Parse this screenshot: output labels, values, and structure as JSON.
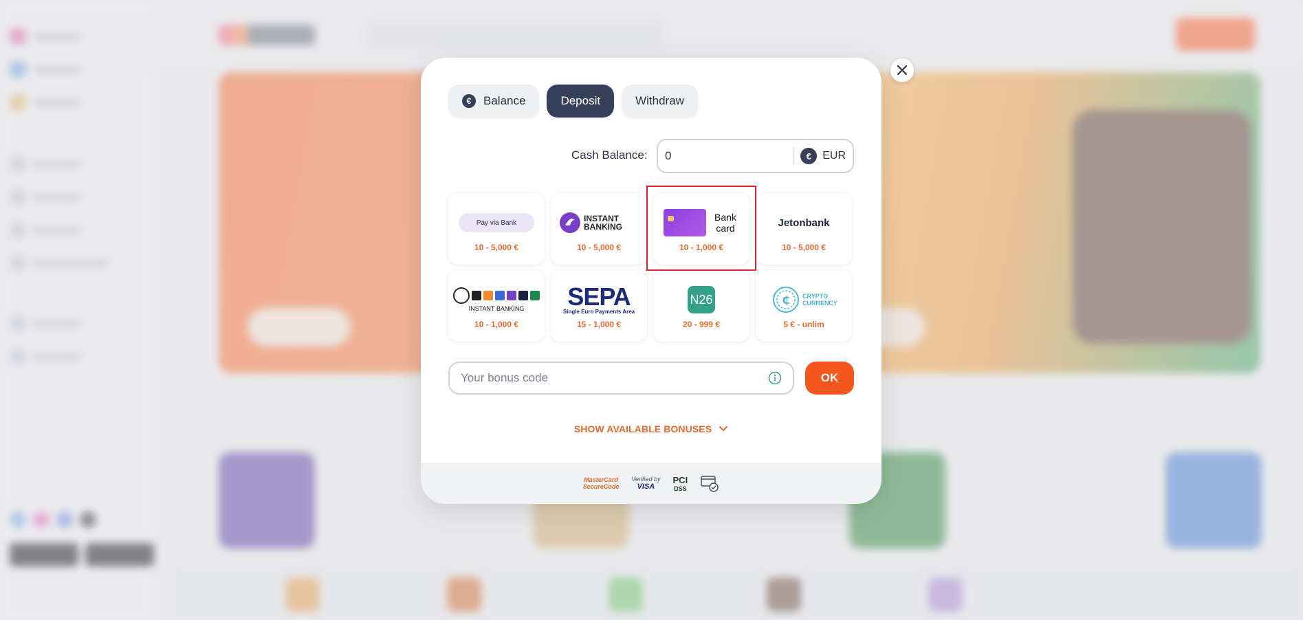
{
  "tabs": [
    {
      "label": "Balance",
      "icon": "euro-icon",
      "active": false
    },
    {
      "label": "Deposit",
      "active": true
    },
    {
      "label": "Withdraw",
      "active": false
    }
  ],
  "cash_balance": {
    "label": "Cash Balance:",
    "value": "0",
    "currency": "EUR",
    "currency_symbol": "€"
  },
  "payment_methods": [
    {
      "name": "Pay via Bank",
      "range": "10 - 5,000 €",
      "icon": "pay-via-bank-logo"
    },
    {
      "name": "INSTANT BANKING",
      "range": "10 - 5,000 €",
      "icon": "instant-banking-logo"
    },
    {
      "name": "Bank card",
      "range": "10 - 1,000 €",
      "icon": "bank-card-logo",
      "selected": true
    },
    {
      "name": "Jetonbank",
      "range": "10 - 5,000 €",
      "icon": "jetonbank-logo"
    },
    {
      "name": "INSTANT BANKING",
      "range": "10 - 1,000 €",
      "icon": "instant-banking-multi-logo"
    },
    {
      "name": "SEPA",
      "subtitle": "Single Euro Payments Area",
      "range": "15 - 1,000 €",
      "icon": "sepa-logo"
    },
    {
      "name": "N26",
      "range": "20 - 999 €",
      "icon": "n26-logo"
    },
    {
      "name": "CRYPTO CURRENCY",
      "range": "5 € - unlim",
      "icon": "crypto-logo"
    }
  ],
  "bonus": {
    "placeholder": "Your bonus code",
    "ok_label": "OK"
  },
  "show_bonuses_label": "SHOW AVAILABLE BONUSES",
  "footer_badges": [
    {
      "line1": "MasterCard",
      "line2": "SecureCode"
    },
    {
      "line1": "Verified by",
      "line2": "VISA"
    },
    {
      "line1": "PCI",
      "line2": "DSS"
    },
    {
      "name": "secure-payment-icon"
    }
  ],
  "colors": {
    "accent": "#f4571e",
    "range_text": "#f0682d",
    "active_tab": "#36405a",
    "highlight": "#e32128"
  }
}
